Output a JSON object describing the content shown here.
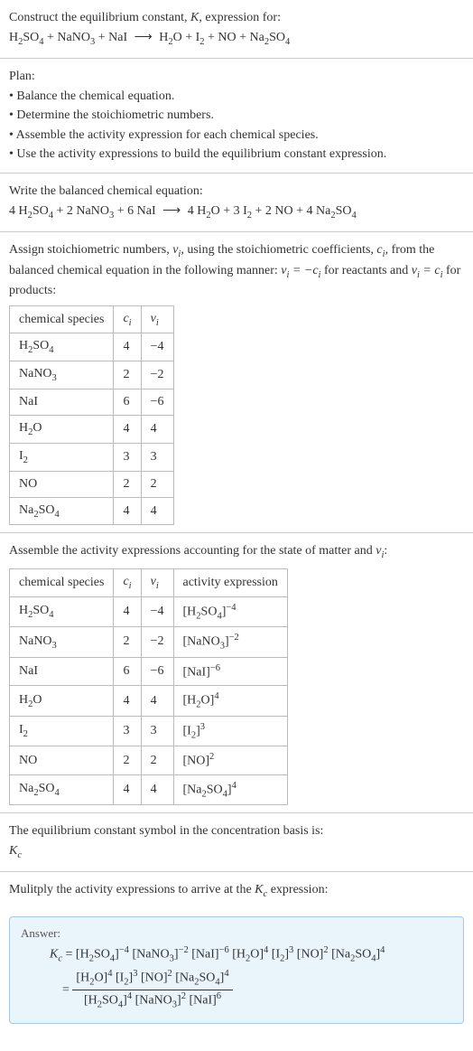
{
  "prompt": {
    "line1_prefix": "Construct the equilibrium constant, ",
    "K": "K",
    "line1_suffix": ", expression for:"
  },
  "reaction_unbalanced": {
    "reactants": [
      "H_2SO_4",
      "NaNO_3",
      "NaI"
    ],
    "products": [
      "H_2O",
      "I_2",
      "NO",
      "Na_2SO_4"
    ]
  },
  "plan": {
    "heading": "Plan:",
    "items": [
      "Balance the chemical equation.",
      "Determine the stoichiometric numbers.",
      "Assemble the activity expression for each chemical species.",
      "Use the activity expressions to build the equilibrium constant expression."
    ]
  },
  "balanced_heading": "Write the balanced chemical equation:",
  "reaction_balanced": {
    "reactants": [
      {
        "coef": "4",
        "species": "H_2SO_4"
      },
      {
        "coef": "2",
        "species": "NaNO_3"
      },
      {
        "coef": "6",
        "species": "NaI"
      }
    ],
    "products": [
      {
        "coef": "4",
        "species": "H_2O"
      },
      {
        "coef": "3",
        "species": "I_2"
      },
      {
        "coef": "2",
        "species": "NO"
      },
      {
        "coef": "4",
        "species": "Na_2SO_4"
      }
    ]
  },
  "stoich_text": {
    "p1": "Assign stoichiometric numbers, ",
    "vi": "ν_i",
    "p2": ", using the stoichiometric coefficients, ",
    "ci": "c_i",
    "p3": ", from the balanced chemical equation in the following manner: ",
    "rel1": "ν_i = −c_i",
    "p4": " for reactants and ",
    "rel2": "ν_i = c_i",
    "p5": " for products:"
  },
  "stoich_table": {
    "headers": [
      "chemical species",
      "c_i",
      "ν_i"
    ],
    "rows": [
      {
        "species": "H_2SO_4",
        "c": "4",
        "v": "−4"
      },
      {
        "species": "NaNO_3",
        "c": "2",
        "v": "−2"
      },
      {
        "species": "NaI",
        "c": "6",
        "v": "−6"
      },
      {
        "species": "H_2O",
        "c": "4",
        "v": "4"
      },
      {
        "species": "I_2",
        "c": "3",
        "v": "3"
      },
      {
        "species": "NO",
        "c": "2",
        "v": "2"
      },
      {
        "species": "Na_2SO_4",
        "c": "4",
        "v": "4"
      }
    ]
  },
  "activity_text": {
    "p1": "Assemble the activity expressions accounting for the state of matter and ",
    "vi": "ν_i",
    "p2": ":"
  },
  "activity_table": {
    "headers": [
      "chemical species",
      "c_i",
      "ν_i",
      "activity expression"
    ],
    "rows": [
      {
        "species": "H_2SO_4",
        "c": "4",
        "v": "−4",
        "expr_species": "H_2SO_4",
        "expr_pow": "−4"
      },
      {
        "species": "NaNO_3",
        "c": "2",
        "v": "−2",
        "expr_species": "NaNO_3",
        "expr_pow": "−2"
      },
      {
        "species": "NaI",
        "c": "6",
        "v": "−6",
        "expr_species": "NaI",
        "expr_pow": "−6"
      },
      {
        "species": "H_2O",
        "c": "4",
        "v": "4",
        "expr_species": "H_2O",
        "expr_pow": "4"
      },
      {
        "species": "I_2",
        "c": "3",
        "v": "3",
        "expr_species": "I_2",
        "expr_pow": "3"
      },
      {
        "species": "NO",
        "c": "2",
        "v": "2",
        "expr_species": "NO",
        "expr_pow": "2"
      },
      {
        "species": "Na_2SO_4",
        "c": "4",
        "v": "4",
        "expr_species": "Na_2SO_4",
        "expr_pow": "4"
      }
    ]
  },
  "kc_symbol_text": "The equilibrium constant symbol in the concentration basis is:",
  "kc_symbol": "K_c",
  "multiply_text": {
    "p1": "Mulitply the activity expressions to arrive at the ",
    "kc": "K_c",
    "p2": " expression:"
  },
  "answer": {
    "label": "Answer:",
    "kc": "K_c",
    "terms_line1": [
      {
        "species": "H_2SO_4",
        "pow": "−4"
      },
      {
        "species": "NaNO_3",
        "pow": "−2"
      },
      {
        "species": "NaI",
        "pow": "−6"
      },
      {
        "species": "H_2O",
        "pow": "4"
      },
      {
        "species": "I_2",
        "pow": "3"
      },
      {
        "species": "NO",
        "pow": "2"
      },
      {
        "species": "Na_2SO_4",
        "pow": "4"
      }
    ],
    "numerator": [
      {
        "species": "H_2O",
        "pow": "4"
      },
      {
        "species": "I_2",
        "pow": "3"
      },
      {
        "species": "NO",
        "pow": "2"
      },
      {
        "species": "Na_2SO_4",
        "pow": "4"
      }
    ],
    "denominator": [
      {
        "species": "H_2SO_4",
        "pow": "4"
      },
      {
        "species": "NaNO_3",
        "pow": "2"
      },
      {
        "species": "NaI",
        "pow": "6"
      }
    ]
  },
  "chart_data": {
    "type": "table",
    "tables": [
      {
        "title": "stoichiometric numbers",
        "columns": [
          "chemical species",
          "c_i",
          "ν_i"
        ],
        "rows": [
          [
            "H2SO4",
            4,
            -4
          ],
          [
            "NaNO3",
            2,
            -2
          ],
          [
            "NaI",
            6,
            -6
          ],
          [
            "H2O",
            4,
            4
          ],
          [
            "I2",
            3,
            3
          ],
          [
            "NO",
            2,
            2
          ],
          [
            "Na2SO4",
            4,
            4
          ]
        ]
      },
      {
        "title": "activity expressions",
        "columns": [
          "chemical species",
          "c_i",
          "ν_i",
          "activity expression"
        ],
        "rows": [
          [
            "H2SO4",
            4,
            -4,
            "[H2SO4]^-4"
          ],
          [
            "NaNO3",
            2,
            -2,
            "[NaNO3]^-2"
          ],
          [
            "NaI",
            6,
            -6,
            "[NaI]^-6"
          ],
          [
            "H2O",
            4,
            4,
            "[H2O]^4"
          ],
          [
            "I2",
            3,
            3,
            "[I2]^3"
          ],
          [
            "NO",
            2,
            2,
            "[NO]^2"
          ],
          [
            "Na2SO4",
            4,
            4,
            "[Na2SO4]^4"
          ]
        ]
      }
    ]
  }
}
